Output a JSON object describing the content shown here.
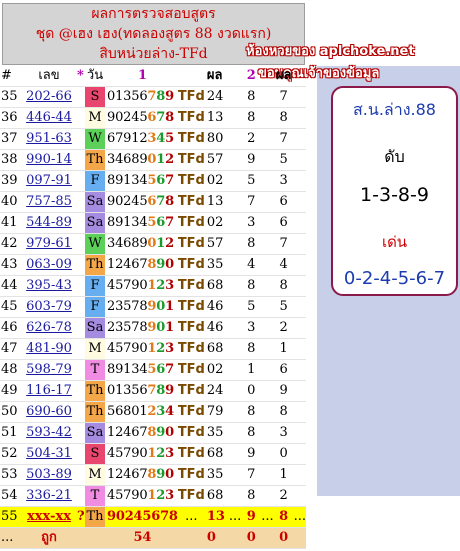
{
  "header": {
    "line1": "ผลการตรวจสอบสูตร",
    "line2": "ชุด @เฮง เฮง(ทดลองสูตร 88 งวดแรก)",
    "line3": "สิบหน่วยล่าง-TFd"
  },
  "watermark": {
    "line1": "ห้องหวยของ aplchoke.net",
    "line2": "ขอบคุณเจ้าของข้อมูล"
  },
  "columns": {
    "no": "#",
    "code": "เลข",
    "star": "*",
    "day": "วัน",
    "d1": "1",
    "result": "ผล",
    "d2": "2",
    "res2": "ผล"
  },
  "rows": [
    {
      "no": "35",
      "code": "202-66",
      "day": "S",
      "q": "01356789",
      "t": "TFd",
      "v": "24",
      "a": "8",
      "b": "7"
    },
    {
      "no": "36",
      "code": "446-44",
      "day": "M",
      "q": "90245678",
      "t": "TFd",
      "v": "13",
      "a": "8",
      "b": "8"
    },
    {
      "no": "37",
      "code": "951-63",
      "day": "W",
      "q": "67912345",
      "t": "TFd",
      "v": "80",
      "a": "2",
      "b": "7"
    },
    {
      "no": "38",
      "code": "990-14",
      "day": "Th",
      "q": "34689012",
      "t": "TFd",
      "v": "57",
      "a": "9",
      "b": "5"
    },
    {
      "no": "39",
      "code": "097-91",
      "day": "F",
      "q": "89134567",
      "t": "TFd",
      "v": "02",
      "a": "5",
      "b": "3"
    },
    {
      "no": "40",
      "code": "757-85",
      "day": "Sa",
      "q": "90245678",
      "t": "TFd",
      "v": "13",
      "a": "7",
      "b": "6"
    },
    {
      "no": "41",
      "code": "544-89",
      "day": "Sa",
      "q": "89134567",
      "t": "TFd",
      "v": "02",
      "a": "3",
      "b": "6"
    },
    {
      "no": "42",
      "code": "979-61",
      "day": "W",
      "q": "34689012",
      "t": "TFd",
      "v": "57",
      "a": "8",
      "b": "7"
    },
    {
      "no": "43",
      "code": "063-09",
      "day": "Th",
      "q": "12467890",
      "t": "TFd",
      "v": "35",
      "a": "4",
      "b": "4"
    },
    {
      "no": "44",
      "code": "395-43",
      "day": "F",
      "q": "45790123",
      "t": "TFd",
      "v": "68",
      "a": "8",
      "b": "8"
    },
    {
      "no": "45",
      "code": "603-79",
      "day": "F",
      "q": "23578901",
      "t": "TFd",
      "v": "46",
      "a": "5",
      "b": "5"
    },
    {
      "no": "46",
      "code": "626-78",
      "day": "Sa",
      "q": "23578901",
      "t": "TFd",
      "v": "46",
      "a": "3",
      "b": "2"
    },
    {
      "no": "47",
      "code": "481-90",
      "day": "M",
      "q": "45790123",
      "t": "TFd",
      "v": "68",
      "a": "8",
      "b": "1"
    },
    {
      "no": "48",
      "code": "598-79",
      "day": "T",
      "q": "89134567",
      "t": "TFd",
      "v": "02",
      "a": "1",
      "b": "6"
    },
    {
      "no": "49",
      "code": "116-17",
      "day": "Th",
      "q": "01356789",
      "t": "TFd",
      "v": "24",
      "a": "0",
      "b": "9"
    },
    {
      "no": "50",
      "code": "690-60",
      "day": "Th",
      "q": "56801234",
      "t": "TFd",
      "v": "79",
      "a": "8",
      "b": "8"
    },
    {
      "no": "51",
      "code": "593-42",
      "day": "Sa",
      "q": "12467890",
      "t": "TFd",
      "v": "35",
      "a": "8",
      "b": "3"
    },
    {
      "no": "52",
      "code": "504-31",
      "day": "S",
      "q": "45790123",
      "t": "TFd",
      "v": "68",
      "a": "9",
      "b": "0"
    },
    {
      "no": "53",
      "code": "503-89",
      "day": "M",
      "q": "12467890",
      "t": "TFd",
      "v": "35",
      "a": "7",
      "b": "1"
    },
    {
      "no": "54",
      "code": "336-21",
      "day": "T",
      "q": "45790123",
      "t": "TFd",
      "v": "68",
      "a": "8",
      "b": "2"
    }
  ],
  "current_row": {
    "no": "55",
    "code": "xxx-xx",
    "star": "?",
    "day": "Th",
    "q": "90245678",
    "dots1": "...",
    "v": "13",
    "dots2": "...",
    "a": "9",
    "dots3": "...",
    "b": "8",
    "dots4": "..."
  },
  "summary_row": {
    "dots": "...",
    "label": "ถูก",
    "hits": "54",
    "z1": "0",
    "z2": "0",
    "z3": "0"
  },
  "panel": {
    "title": "ส.น.ล่าง.88",
    "sub": "ดับ",
    "drop": "1-3-8-9",
    "hot_label": "เด่น",
    "hot": "0-2-4-5-6-7"
  },
  "colors": {
    "header_text": "#cc0000",
    "panel_border": "#8a1a4a",
    "panel_text": "#1c3cb0",
    "current_row": "#ffff00",
    "summary_row": "#f4d9a6"
  }
}
